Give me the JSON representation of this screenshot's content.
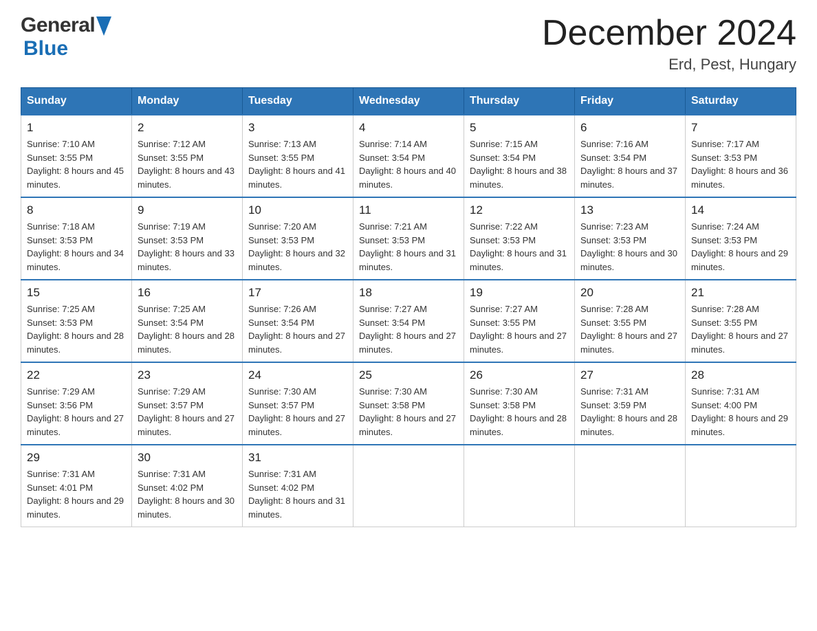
{
  "header": {
    "logo_general": "General",
    "logo_blue": "Blue",
    "month_title": "December 2024",
    "location": "Erd, Pest, Hungary"
  },
  "days_of_week": [
    "Sunday",
    "Monday",
    "Tuesday",
    "Wednesday",
    "Thursday",
    "Friday",
    "Saturday"
  ],
  "weeks": [
    [
      {
        "day": "1",
        "sunrise": "Sunrise: 7:10 AM",
        "sunset": "Sunset: 3:55 PM",
        "daylight": "Daylight: 8 hours and 45 minutes."
      },
      {
        "day": "2",
        "sunrise": "Sunrise: 7:12 AM",
        "sunset": "Sunset: 3:55 PM",
        "daylight": "Daylight: 8 hours and 43 minutes."
      },
      {
        "day": "3",
        "sunrise": "Sunrise: 7:13 AM",
        "sunset": "Sunset: 3:55 PM",
        "daylight": "Daylight: 8 hours and 41 minutes."
      },
      {
        "day": "4",
        "sunrise": "Sunrise: 7:14 AM",
        "sunset": "Sunset: 3:54 PM",
        "daylight": "Daylight: 8 hours and 40 minutes."
      },
      {
        "day": "5",
        "sunrise": "Sunrise: 7:15 AM",
        "sunset": "Sunset: 3:54 PM",
        "daylight": "Daylight: 8 hours and 38 minutes."
      },
      {
        "day": "6",
        "sunrise": "Sunrise: 7:16 AM",
        "sunset": "Sunset: 3:54 PM",
        "daylight": "Daylight: 8 hours and 37 minutes."
      },
      {
        "day": "7",
        "sunrise": "Sunrise: 7:17 AM",
        "sunset": "Sunset: 3:53 PM",
        "daylight": "Daylight: 8 hours and 36 minutes."
      }
    ],
    [
      {
        "day": "8",
        "sunrise": "Sunrise: 7:18 AM",
        "sunset": "Sunset: 3:53 PM",
        "daylight": "Daylight: 8 hours and 34 minutes."
      },
      {
        "day": "9",
        "sunrise": "Sunrise: 7:19 AM",
        "sunset": "Sunset: 3:53 PM",
        "daylight": "Daylight: 8 hours and 33 minutes."
      },
      {
        "day": "10",
        "sunrise": "Sunrise: 7:20 AM",
        "sunset": "Sunset: 3:53 PM",
        "daylight": "Daylight: 8 hours and 32 minutes."
      },
      {
        "day": "11",
        "sunrise": "Sunrise: 7:21 AM",
        "sunset": "Sunset: 3:53 PM",
        "daylight": "Daylight: 8 hours and 31 minutes."
      },
      {
        "day": "12",
        "sunrise": "Sunrise: 7:22 AM",
        "sunset": "Sunset: 3:53 PM",
        "daylight": "Daylight: 8 hours and 31 minutes."
      },
      {
        "day": "13",
        "sunrise": "Sunrise: 7:23 AM",
        "sunset": "Sunset: 3:53 PM",
        "daylight": "Daylight: 8 hours and 30 minutes."
      },
      {
        "day": "14",
        "sunrise": "Sunrise: 7:24 AM",
        "sunset": "Sunset: 3:53 PM",
        "daylight": "Daylight: 8 hours and 29 minutes."
      }
    ],
    [
      {
        "day": "15",
        "sunrise": "Sunrise: 7:25 AM",
        "sunset": "Sunset: 3:53 PM",
        "daylight": "Daylight: 8 hours and 28 minutes."
      },
      {
        "day": "16",
        "sunrise": "Sunrise: 7:25 AM",
        "sunset": "Sunset: 3:54 PM",
        "daylight": "Daylight: 8 hours and 28 minutes."
      },
      {
        "day": "17",
        "sunrise": "Sunrise: 7:26 AM",
        "sunset": "Sunset: 3:54 PM",
        "daylight": "Daylight: 8 hours and 27 minutes."
      },
      {
        "day": "18",
        "sunrise": "Sunrise: 7:27 AM",
        "sunset": "Sunset: 3:54 PM",
        "daylight": "Daylight: 8 hours and 27 minutes."
      },
      {
        "day": "19",
        "sunrise": "Sunrise: 7:27 AM",
        "sunset": "Sunset: 3:55 PM",
        "daylight": "Daylight: 8 hours and 27 minutes."
      },
      {
        "day": "20",
        "sunrise": "Sunrise: 7:28 AM",
        "sunset": "Sunset: 3:55 PM",
        "daylight": "Daylight: 8 hours and 27 minutes."
      },
      {
        "day": "21",
        "sunrise": "Sunrise: 7:28 AM",
        "sunset": "Sunset: 3:55 PM",
        "daylight": "Daylight: 8 hours and 27 minutes."
      }
    ],
    [
      {
        "day": "22",
        "sunrise": "Sunrise: 7:29 AM",
        "sunset": "Sunset: 3:56 PM",
        "daylight": "Daylight: 8 hours and 27 minutes."
      },
      {
        "day": "23",
        "sunrise": "Sunrise: 7:29 AM",
        "sunset": "Sunset: 3:57 PM",
        "daylight": "Daylight: 8 hours and 27 minutes."
      },
      {
        "day": "24",
        "sunrise": "Sunrise: 7:30 AM",
        "sunset": "Sunset: 3:57 PM",
        "daylight": "Daylight: 8 hours and 27 minutes."
      },
      {
        "day": "25",
        "sunrise": "Sunrise: 7:30 AM",
        "sunset": "Sunset: 3:58 PM",
        "daylight": "Daylight: 8 hours and 27 minutes."
      },
      {
        "day": "26",
        "sunrise": "Sunrise: 7:30 AM",
        "sunset": "Sunset: 3:58 PM",
        "daylight": "Daylight: 8 hours and 28 minutes."
      },
      {
        "day": "27",
        "sunrise": "Sunrise: 7:31 AM",
        "sunset": "Sunset: 3:59 PM",
        "daylight": "Daylight: 8 hours and 28 minutes."
      },
      {
        "day": "28",
        "sunrise": "Sunrise: 7:31 AM",
        "sunset": "Sunset: 4:00 PM",
        "daylight": "Daylight: 8 hours and 29 minutes."
      }
    ],
    [
      {
        "day": "29",
        "sunrise": "Sunrise: 7:31 AM",
        "sunset": "Sunset: 4:01 PM",
        "daylight": "Daylight: 8 hours and 29 minutes."
      },
      {
        "day": "30",
        "sunrise": "Sunrise: 7:31 AM",
        "sunset": "Sunset: 4:02 PM",
        "daylight": "Daylight: 8 hours and 30 minutes."
      },
      {
        "day": "31",
        "sunrise": "Sunrise: 7:31 AM",
        "sunset": "Sunset: 4:02 PM",
        "daylight": "Daylight: 8 hours and 31 minutes."
      },
      null,
      null,
      null,
      null
    ]
  ]
}
